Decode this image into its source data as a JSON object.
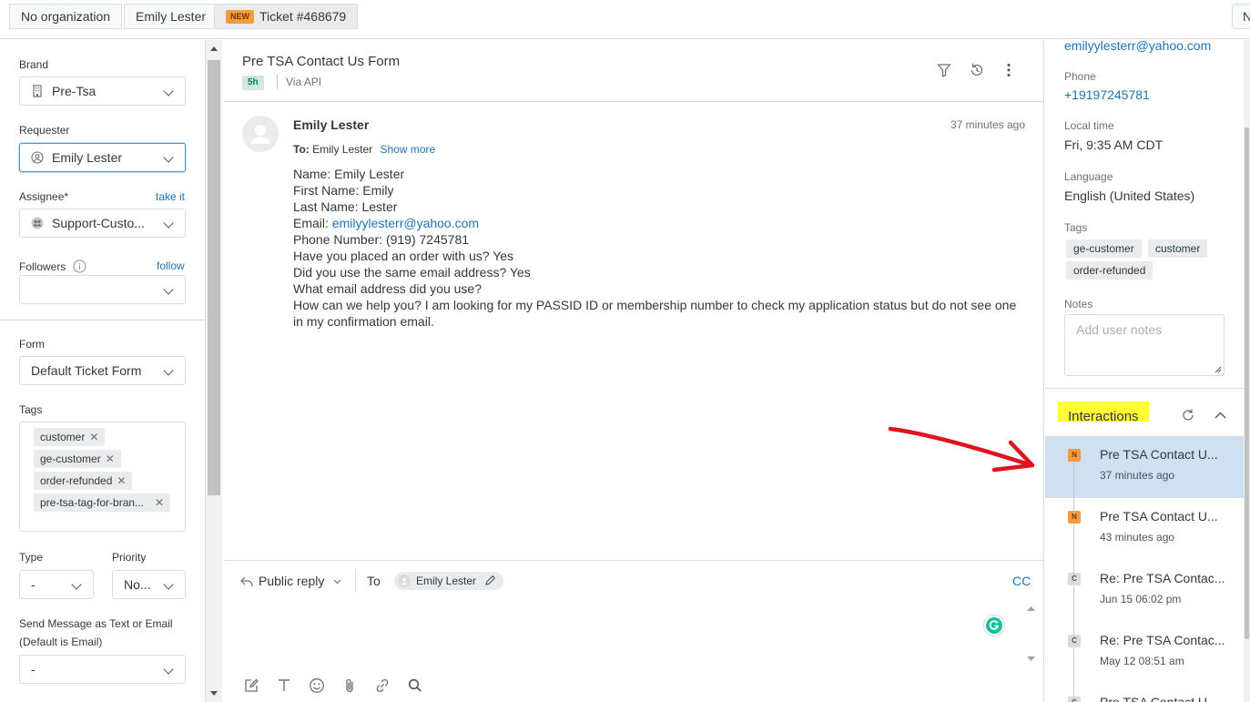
{
  "breadcrumbs": {
    "organization": "No organization",
    "requester": "Emily Lester",
    "ticket_badge": "NEW",
    "ticket": "Ticket #468679",
    "overflow": "N"
  },
  "left_panel": {
    "brand_label": "Brand",
    "brand_value": "Pre-Tsa",
    "requester_label": "Requester",
    "requester_value": "Emily Lester",
    "assignee_label": "Assignee*",
    "assignee_action": "take it",
    "assignee_value": "Support-Custo...",
    "followers_label": "Followers",
    "followers_action": "follow",
    "form_label": "Form",
    "form_value": "Default Ticket Form",
    "tags_label": "Tags",
    "tags": [
      "customer",
      "ge-customer",
      "order-refunded",
      "pre-tsa-tag-for-bran..."
    ],
    "type_label": "Type",
    "type_value": "-",
    "priority_label": "Priority",
    "priority_value": "No...",
    "send_label_line1": "Send Message as Text or Email",
    "send_label_line2": "(Default is Email)",
    "send_value": "-"
  },
  "conversation": {
    "subject": "Pre TSA Contact Us Form",
    "age": "5h",
    "channel": "Via API",
    "message": {
      "author": "Emily Lester",
      "time": "37 minutes ago",
      "to_label": "To:",
      "to_value": "Emily Lester",
      "show_more": "Show more",
      "lines": [
        "Name: Emily Lester",
        "First Name: Emily",
        "Last Name: Lester",
        "Phone Number: (919) 7245781",
        "Have you placed an order with us? Yes",
        "Did you use the same email address? Yes",
        "What email address did you use?",
        "How can we help you? I am looking for my PASSID ID or membership number to check my application status but do not see one in my confirmation email."
      ],
      "email_prefix": "Email: ",
      "email_link": "emilyylesterr@yahoo.com"
    },
    "reply": {
      "mode": "Public reply",
      "to_label": "To",
      "recipient": "Emily Lester",
      "cc": "CC"
    }
  },
  "right_panel": {
    "email": "emilyylesterr@yahoo.com",
    "phone_label": "Phone",
    "phone": "+19197245781",
    "local_time_label": "Local time",
    "local_time": "Fri, 9:35 AM CDT",
    "language_label": "Language",
    "language": "English (United States)",
    "tags_label": "Tags",
    "tags": [
      "ge-customer",
      "customer",
      "order-refunded"
    ],
    "notes_label": "Notes",
    "notes_placeholder": "Add user notes",
    "interactions_title": "Interactions",
    "interactions": [
      {
        "badge": "N",
        "title": "Pre TSA Contact U...",
        "time": "37 minutes ago"
      },
      {
        "badge": "N",
        "title": "Pre TSA Contact U...",
        "time": "43 minutes ago"
      },
      {
        "badge": "C",
        "title": "Re: Pre TSA Contac...",
        "time": "Jun 15 06:02 pm"
      },
      {
        "badge": "C",
        "title": "Re: Pre TSA Contac...",
        "time": "May 12 08:51 am"
      },
      {
        "badge": "C",
        "title": "Pre TSA Contact U...",
        "time": ""
      }
    ]
  },
  "colors": {
    "link": "#1f73b7",
    "new_badge": "#f79a3e",
    "highlight": "#ffff33",
    "annotation_arrow": "#e0141e",
    "selected_row": "#cfe1f1"
  }
}
